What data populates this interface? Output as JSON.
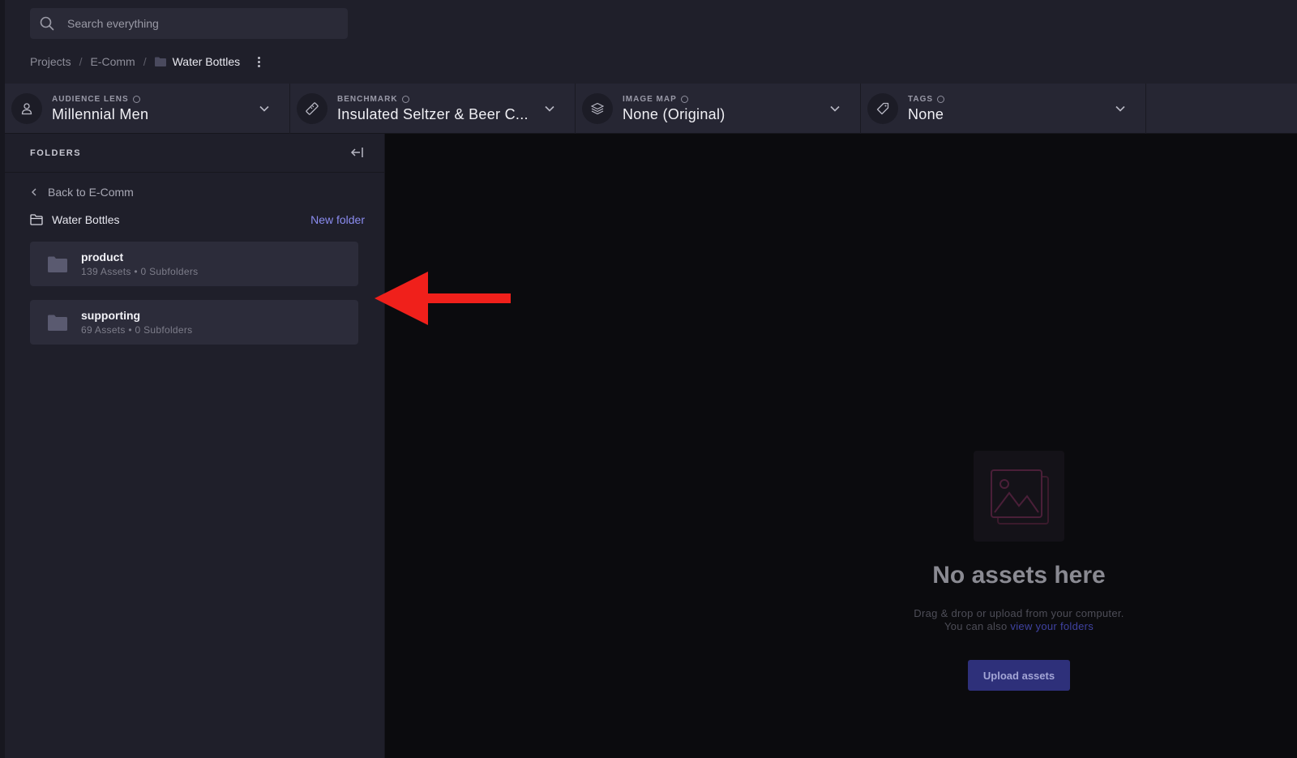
{
  "search": {
    "placeholder": "Search everything"
  },
  "breadcrumb": {
    "items": [
      "Projects",
      "E-Comm"
    ],
    "current": "Water Bottles"
  },
  "filters": [
    {
      "label": "AUDIENCE LENS",
      "value": "Millennial Men",
      "icon": "user-icon"
    },
    {
      "label": "BENCHMARK",
      "value": "Insulated Seltzer & Beer C...",
      "icon": "ruler-icon"
    },
    {
      "label": "IMAGE MAP",
      "value": "None (Original)",
      "icon": "layers-icon"
    },
    {
      "label": "TAGS",
      "value": "None",
      "icon": "tag-icon"
    }
  ],
  "sidebar": {
    "title": "FOLDERS",
    "back_label": "Back to E-Comm",
    "current_folder": "Water Bottles",
    "new_folder_label": "New folder",
    "folders": [
      {
        "name": "product",
        "meta": "139 Assets • 0 Subfolders"
      },
      {
        "name": "supporting",
        "meta": "69 Assets • 0 Subfolders"
      }
    ]
  },
  "empty_state": {
    "title": "No assets here",
    "line1": "Drag & drop or upload from your computer.",
    "line2_prefix": "You can also ",
    "line2_link": "view your folders",
    "upload_label": "Upload assets"
  },
  "colors": {
    "accent": "#8b8cf0",
    "annotation_arrow": "#f0201b",
    "upload_button": "#2e307a"
  }
}
